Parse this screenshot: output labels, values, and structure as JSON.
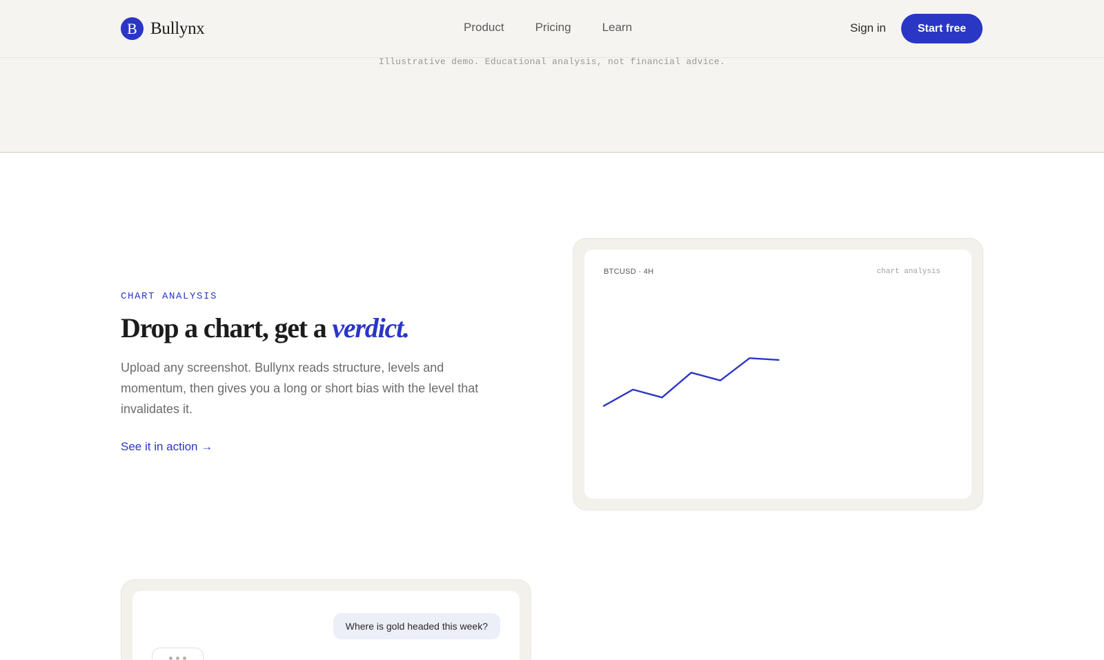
{
  "brand": {
    "logo_letter": "B",
    "name": "Bullynx"
  },
  "nav": {
    "links": [
      "Product",
      "Pricing",
      "Learn"
    ],
    "sign_in": "Sign in",
    "cta": "Start free"
  },
  "hero": {
    "disclaimer": "Illustrative demo. Educational analysis, not financial advice."
  },
  "feature": {
    "eyebrow": "CHART ANALYSIS",
    "headline_plain": "Drop a chart, get a",
    "headline_accent": "verdict.",
    "body": "Upload any screenshot. Bullynx reads structure, levels and momentum, then gives you a long or short bias with the level that invalidates it.",
    "link": "See it in action →"
  },
  "chart_card": {
    "ticker": "BTCUSD · 4H",
    "tag": "chart analysis"
  },
  "chart_data": {
    "type": "line",
    "title": "",
    "xlabel": "",
    "ylabel": "",
    "x": [
      0,
      1,
      2,
      3,
      4,
      5,
      6
    ],
    "values": [
      0,
      27,
      14,
      55,
      42,
      79,
      76
    ],
    "xlim": [
      0,
      12
    ],
    "ylim": [
      -110,
      190
    ],
    "grid": false,
    "line_color": "#2a36c4"
  },
  "chat_card": {
    "user_message": "Where is gold headed this week?"
  },
  "colors": {
    "accent": "#2a36c4",
    "background_band": "#f5f4f0"
  }
}
